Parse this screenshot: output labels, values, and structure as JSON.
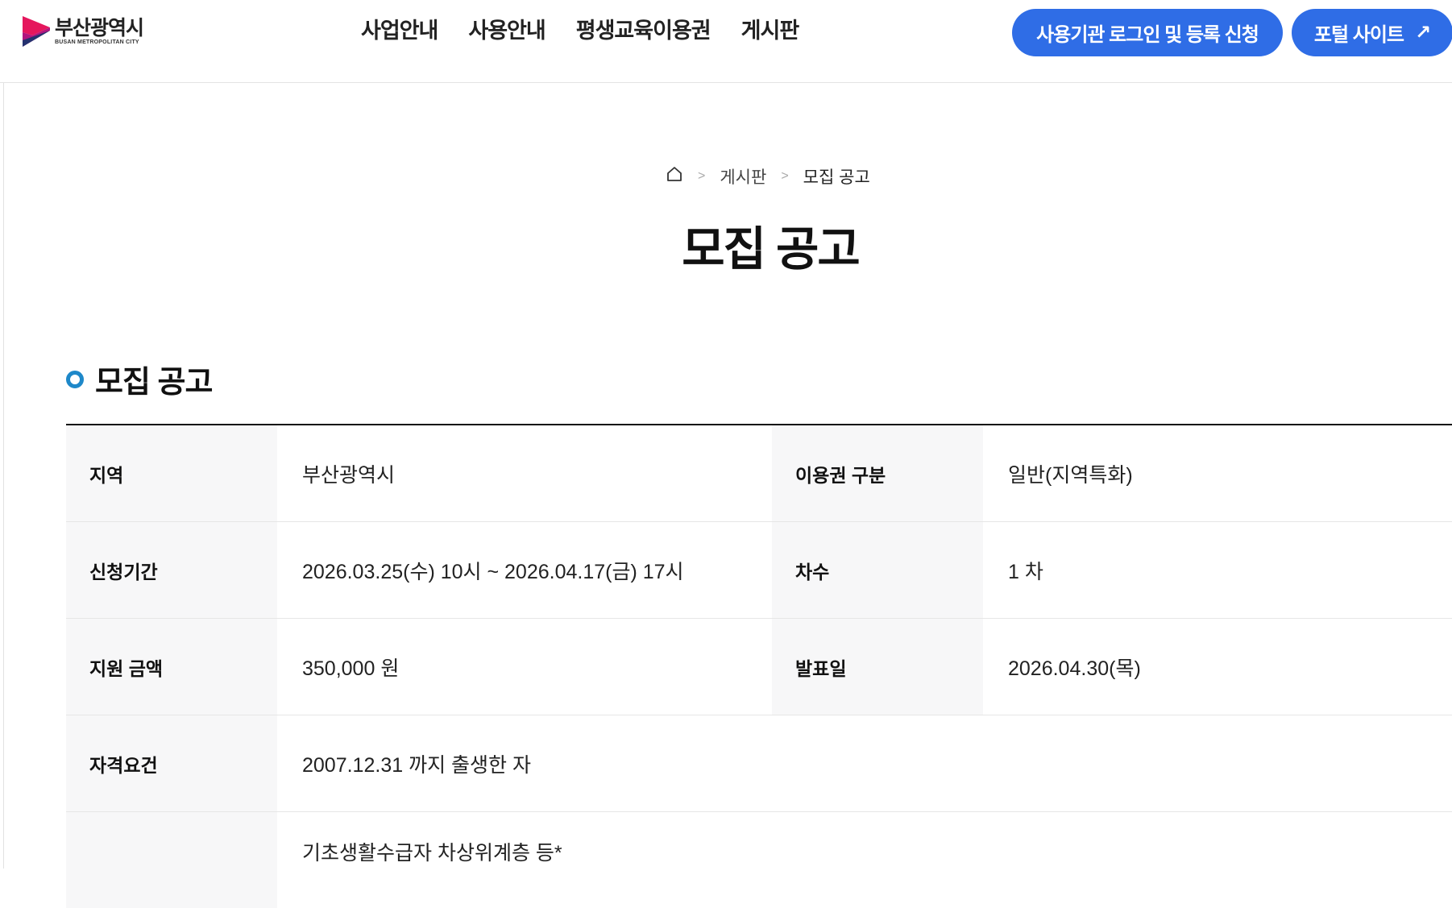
{
  "header": {
    "logo_ko": "부산광역시",
    "logo_en": "BUSAN METROPOLITAN CITY",
    "nav": [
      "사업안내",
      "사용안내",
      "평생교육이용권",
      "게시판"
    ],
    "login_button": "사용기관 로그인 및 등록 신청",
    "portal_button": "포털 사이트",
    "portal_icon": "↗"
  },
  "breadcrumb": {
    "parent": "게시판",
    "current": "모집 공고"
  },
  "page_title": "모집 공고",
  "section_title": "모집 공고",
  "table": {
    "region_label": "지역",
    "region_value": "부산광역시",
    "voucher_label": "이용권 구분",
    "voucher_value": "일반(지역특화)",
    "period_label": "신청기간",
    "period_value": "2026.03.25(수) 10시 ~ 2026.04.17(금) 17시",
    "round_label": "차수",
    "round_value": "1 차",
    "amount_label": "지원 금액",
    "amount_value": "350,000 원",
    "announce_label": "발표일",
    "announce_value": "2026.04.30(목)",
    "eligibility_label": "자격요건",
    "eligibility_value": "2007.12.31 까지 출생한 자",
    "priority_value": "기초생활수급자 차상위계층 등*"
  },
  "colors": {
    "accent": "#2f6de6",
    "section_dot": "#1e88c9",
    "logo_pink": "#e5175d",
    "logo_magenta": "#b1167e",
    "logo_navy": "#25326f"
  }
}
